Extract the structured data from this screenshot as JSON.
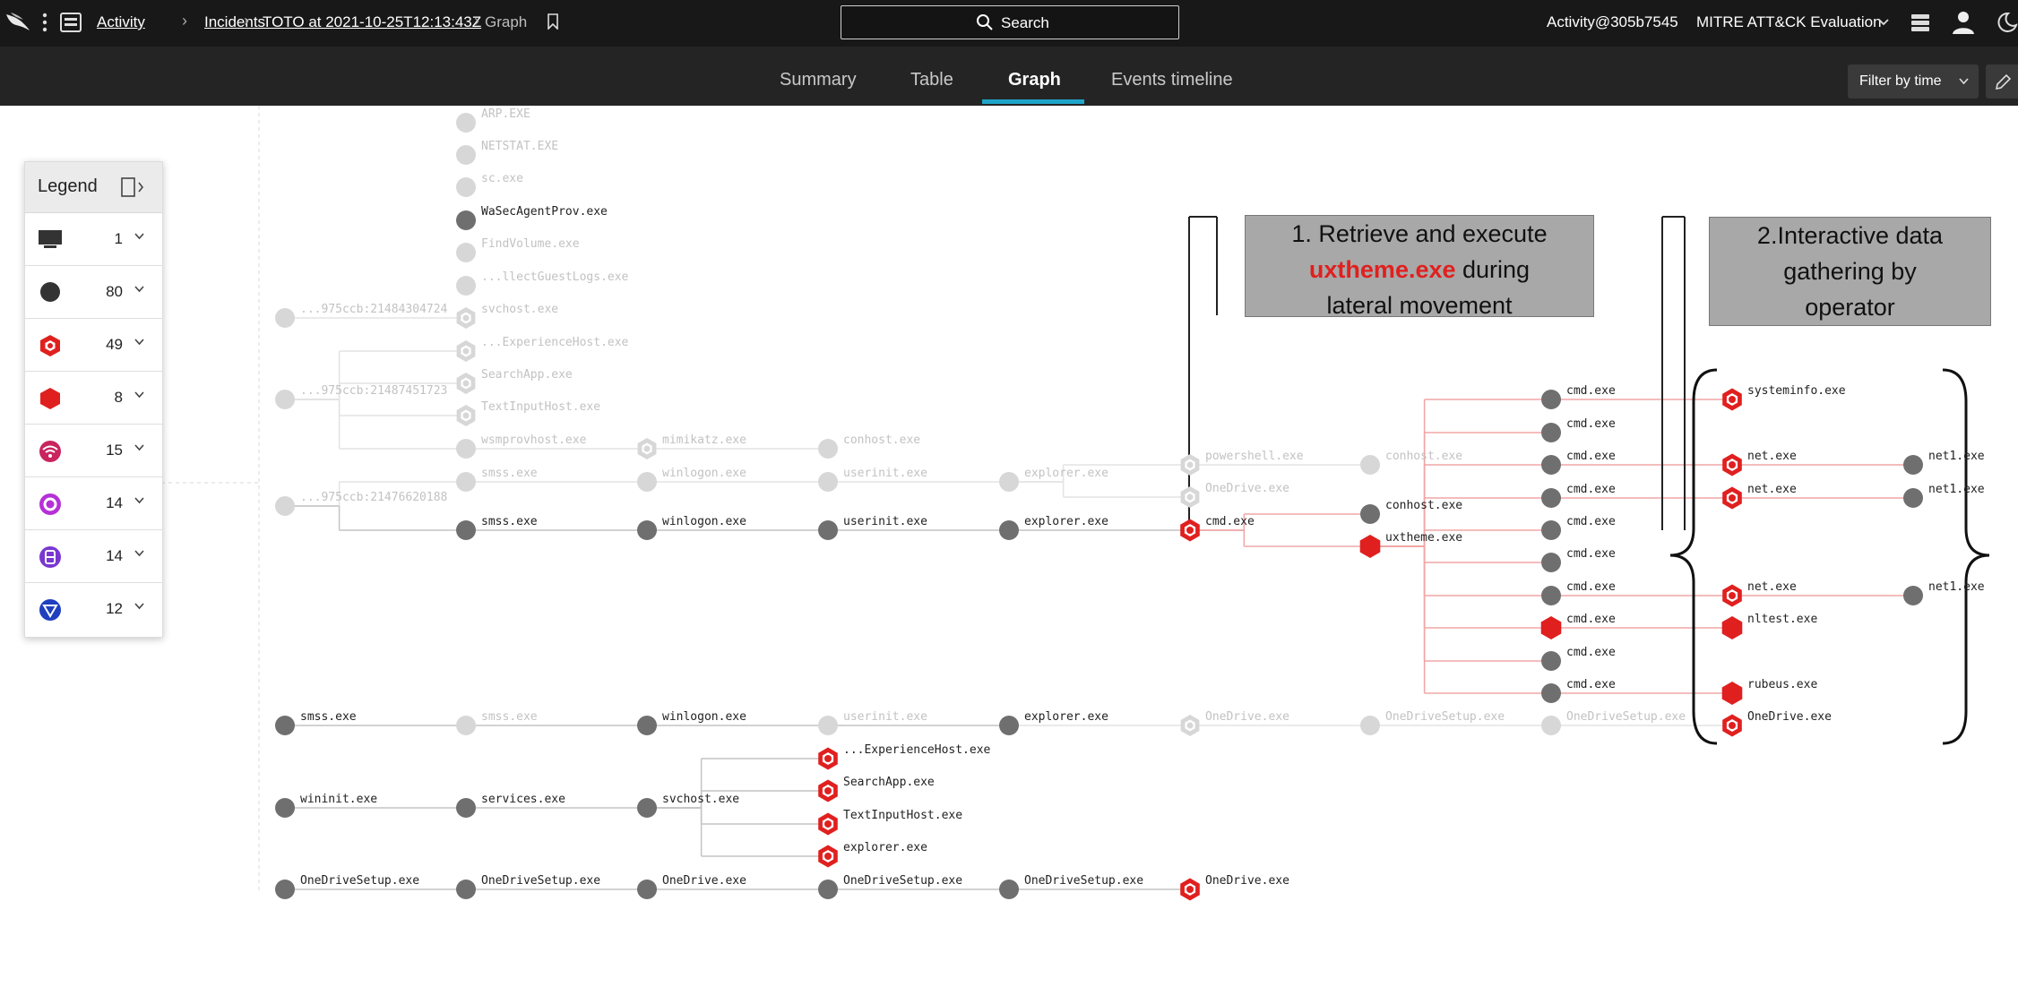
{
  "topbar": {
    "breadcrumb": [
      "Activity",
      "Incidents",
      "TOTO at 2021-10-25T12:13:43Z",
      "Graph"
    ],
    "search_label": "Search",
    "account": "Activity@305b7545",
    "customer": "MITRE ATT&CK Evaluation"
  },
  "tabs": [
    {
      "label": "Summary",
      "active": false
    },
    {
      "label": "Table",
      "active": false
    },
    {
      "label": "Graph",
      "active": true
    },
    {
      "label": "Events timeline",
      "active": false
    }
  ],
  "filter_label": "Filter by time",
  "colors": {
    "accent": "#1fa5c9",
    "alert_red": "#e0201f",
    "node_dark": "#6f6f6f",
    "node_faded": "#d7d7d7",
    "callout_bg": "#a8a8a8"
  },
  "legend": {
    "title": "Legend",
    "items": [
      {
        "icon": "host-icon",
        "count": "1"
      },
      {
        "icon": "process-icon",
        "count": "80"
      },
      {
        "icon": "detection-hexagon-icon",
        "count": "49"
      },
      {
        "icon": "filled-hexagon-icon",
        "count": "8"
      },
      {
        "icon": "network-icon",
        "count": "15"
      },
      {
        "icon": "target-icon",
        "count": "14"
      },
      {
        "icon": "file-icon",
        "count": "14"
      },
      {
        "icon": "dns-icon",
        "count": "12"
      }
    ]
  },
  "callouts": [
    {
      "pre": "1. Retrieve and execute",
      "highlight": "uxtheme.exe",
      "post": " during",
      "last": "lateral movement"
    },
    {
      "line1": "2.Interactive data",
      "line2": "gathering by",
      "line3": "operator"
    }
  ],
  "nodes": [
    {
      "id": "n1",
      "label": "ARP.EXE",
      "type": "faded"
    },
    {
      "id": "n2",
      "label": "NETSTAT.EXE",
      "type": "faded"
    },
    {
      "id": "n3",
      "label": "sc.exe",
      "type": "faded"
    },
    {
      "id": "n4",
      "label": "WaSecAgentProv.exe",
      "type": "dark"
    },
    {
      "id": "n5",
      "label": "FindVolume.exe",
      "type": "faded"
    },
    {
      "id": "n6",
      "label": "...llectGuestLogs.exe",
      "type": "faded"
    },
    {
      "id": "n7",
      "label": "...975ccb:21484304724",
      "type": "faded"
    },
    {
      "id": "n8",
      "label": "svchost.exe",
      "type": "faded-hex"
    },
    {
      "id": "n9",
      "label": "...ExperienceHost.exe",
      "type": "faded-hex"
    },
    {
      "id": "n10",
      "label": "SearchApp.exe",
      "type": "faded-hex"
    },
    {
      "id": "n11",
      "label": "...975ccb:21487451723",
      "type": "faded"
    },
    {
      "id": "n12",
      "label": "TextInputHost.exe",
      "type": "faded-hex"
    },
    {
      "id": "n13",
      "label": "wsmprovhost.exe",
      "type": "faded"
    },
    {
      "id": "n14",
      "label": "mimikatz.exe",
      "type": "faded-hex"
    },
    {
      "id": "n15",
      "label": "conhost.exe",
      "type": "faded"
    },
    {
      "id": "n16",
      "label": "smss.exe",
      "type": "faded"
    },
    {
      "id": "n17",
      "label": "winlogon.exe",
      "type": "faded"
    },
    {
      "id": "n18",
      "label": "userinit.exe",
      "type": "faded"
    },
    {
      "id": "n19",
      "label": "explorer.exe",
      "type": "faded"
    },
    {
      "id": "n20",
      "label": "powershell.exe",
      "type": "faded-hex"
    },
    {
      "id": "n21",
      "label": "conhost.exe",
      "type": "faded"
    },
    {
      "id": "n22",
      "label": "OneDrive.exe",
      "type": "faded-hex"
    },
    {
      "id": "n23",
      "label": "...975ccb:21476620188",
      "type": "faded"
    },
    {
      "id": "n24",
      "label": "smss.exe",
      "type": "dark"
    },
    {
      "id": "n25",
      "label": "winlogon.exe",
      "type": "dark"
    },
    {
      "id": "n26",
      "label": "userinit.exe",
      "type": "dark"
    },
    {
      "id": "n27",
      "label": "explorer.exe",
      "type": "dark"
    },
    {
      "id": "n28",
      "label": "cmd.exe",
      "type": "red-hex"
    },
    {
      "id": "n29",
      "label": "conhost.exe",
      "type": "dark"
    },
    {
      "id": "n30",
      "label": "uxtheme.exe",
      "type": "red-filled"
    },
    {
      "id": "c1",
      "label": "cmd.exe",
      "type": "dark"
    },
    {
      "id": "c2",
      "label": "cmd.exe",
      "type": "dark"
    },
    {
      "id": "c3",
      "label": "cmd.exe",
      "type": "dark"
    },
    {
      "id": "c4",
      "label": "cmd.exe",
      "type": "dark"
    },
    {
      "id": "c5",
      "label": "cmd.exe",
      "type": "dark"
    },
    {
      "id": "c6",
      "label": "cmd.exe",
      "type": "dark"
    },
    {
      "id": "c7",
      "label": "cmd.exe",
      "type": "dark"
    },
    {
      "id": "c8",
      "label": "cmd.exe",
      "type": "red-filled"
    },
    {
      "id": "c9",
      "label": "cmd.exe",
      "type": "dark"
    },
    {
      "id": "c10",
      "label": "cmd.exe",
      "type": "dark"
    },
    {
      "id": "r1",
      "label": "systeminfo.exe",
      "type": "red-hex"
    },
    {
      "id": "r2",
      "label": "net.exe",
      "type": "red-hex"
    },
    {
      "id": "r3",
      "label": "net.exe",
      "type": "red-hex"
    },
    {
      "id": "r4",
      "label": "net.exe",
      "type": "red-hex"
    },
    {
      "id": "r5",
      "label": "nltest.exe",
      "type": "red-filled"
    },
    {
      "id": "r6",
      "label": "rubeus.exe",
      "type": "red-filled"
    },
    {
      "id": "r7",
      "label": "OneDrive.exe",
      "type": "red-hex"
    },
    {
      "id": "t1",
      "label": "net1.exe",
      "type": "dark"
    },
    {
      "id": "t2",
      "label": "net1.exe",
      "type": "dark"
    },
    {
      "id": "t3",
      "label": "net1.exe",
      "type": "dark"
    },
    {
      "id": "m1",
      "label": "smss.exe",
      "type": "dark"
    },
    {
      "id": "m2",
      "label": "smss.exe",
      "type": "faded"
    },
    {
      "id": "m3",
      "label": "winlogon.exe",
      "type": "dark"
    },
    {
      "id": "m4",
      "label": "userinit.exe",
      "type": "faded"
    },
    {
      "id": "m5",
      "label": "explorer.exe",
      "type": "dark"
    },
    {
      "id": "m6",
      "label": "OneDrive.exe",
      "type": "faded-hex"
    },
    {
      "id": "m7",
      "label": "OneDriveSetup.exe",
      "type": "faded"
    },
    {
      "id": "m8",
      "label": "OneDriveSetup.exe",
      "type": "faded"
    },
    {
      "id": "w1",
      "label": "wininit.exe",
      "type": "dark"
    },
    {
      "id": "w2",
      "label": "services.exe",
      "type": "dark"
    },
    {
      "id": "w3",
      "label": "svchost.exe",
      "type": "dark"
    },
    {
      "id": "w4",
      "label": "...ExperienceHost.exe",
      "type": "red-hex"
    },
    {
      "id": "w5",
      "label": "SearchApp.exe",
      "type": "red-hex"
    },
    {
      "id": "w6",
      "label": "TextInputHost.exe",
      "type": "red-hex"
    },
    {
      "id": "w7",
      "label": "explorer.exe",
      "type": "red-hex"
    },
    {
      "id": "o1",
      "label": "OneDriveSetup.exe",
      "type": "dark"
    },
    {
      "id": "o2",
      "label": "OneDriveSetup.exe",
      "type": "dark"
    },
    {
      "id": "o3",
      "label": "OneDrive.exe",
      "type": "dark"
    },
    {
      "id": "o4",
      "label": "OneDriveSetup.exe",
      "type": "dark"
    },
    {
      "id": "o5",
      "label": "OneDriveSetup.exe",
      "type": "dark"
    },
    {
      "id": "o6",
      "label": "OneDrive.exe",
      "type": "red-hex"
    }
  ]
}
